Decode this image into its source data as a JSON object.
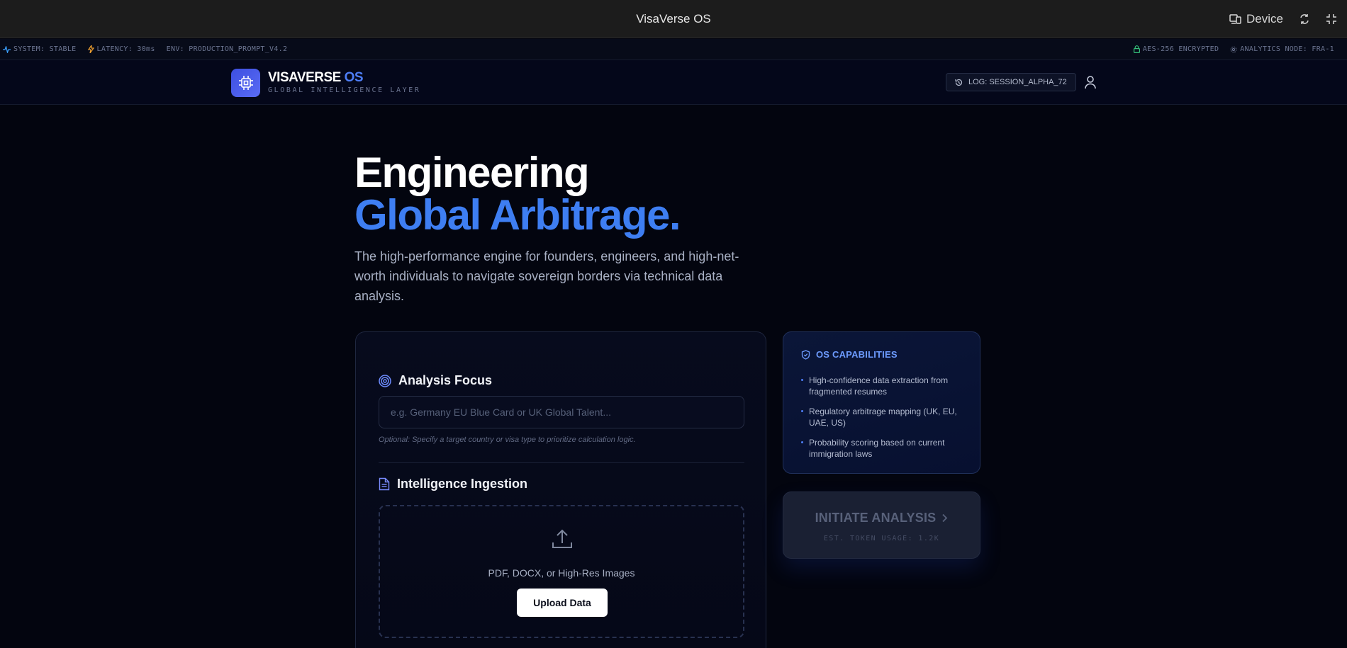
{
  "window": {
    "title": "VisaVerse OS",
    "device_label": "Device"
  },
  "status_bar": {
    "system": "SYSTEM: STABLE",
    "latency": "LATENCY: 30ms",
    "env": "ENV: PRODUCTION_PROMPT_V4.2",
    "encryption": "AES-256 ENCRYPTED",
    "analytics_node": "ANALYTICS NODE: FRA-1"
  },
  "header": {
    "brand_main": "VISAVERSE",
    "brand_os": "OS",
    "brand_sub": "GLOBAL INTELLIGENCE LAYER",
    "log_label": "LOG: SESSION_ALPHA_72"
  },
  "hero": {
    "line1": "Engineering",
    "line2": "Global Arbitrage.",
    "lead": "The high-performance engine for founders, engineers, and high-net-worth individuals to navigate sovereign borders via technical data analysis."
  },
  "form": {
    "focus_title": "Analysis Focus",
    "focus_placeholder": "e.g. Germany EU Blue Card or UK Global Talent...",
    "focus_value": "",
    "focus_hint": "Optional: Specify a target country or visa type to prioritize calculation logic.",
    "ingestion_title": "Intelligence Ingestion",
    "drop_text": "PDF, DOCX, or High-Res Images",
    "upload_label": "Upload Data"
  },
  "capabilities": {
    "title": "OS CAPABILITIES",
    "items": [
      "High-confidence data extraction from fragmented resumes",
      "Regulatory arbitrage mapping (UK, EU, UAE, US)",
      "Probability scoring based on current immigration laws"
    ]
  },
  "action": {
    "label": "INITIATE ANALYSIS",
    "sub": "EST. TOKEN USAGE: 1.2K"
  },
  "colors": {
    "accent": "#3e7ef2",
    "background": "#03050f",
    "status_ok": "#3aa0ff",
    "latency": "#f0a030",
    "lock": "#35c27a"
  }
}
